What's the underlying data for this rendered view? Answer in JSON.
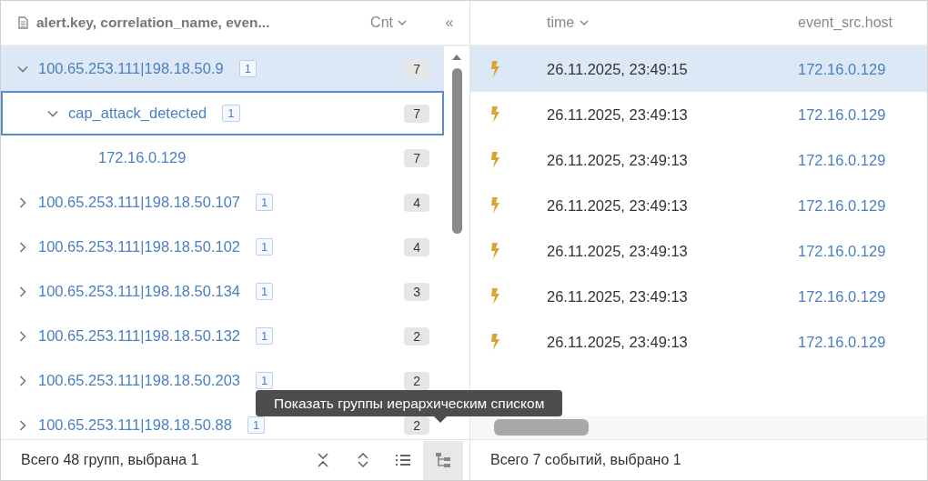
{
  "groups_panel": {
    "header": {
      "title": "alert.key, correlation_name, even...",
      "count_column": "Cnt",
      "collapse_button": "«"
    },
    "groups": [
      {
        "label": "100.65.253.111|198.18.50.9",
        "badge": "1",
        "count": "7",
        "expanded": true,
        "selected": true,
        "focused": false,
        "children": [
          {
            "label": "cap_attack_detected",
            "badge": "1",
            "count": "7",
            "expanded": true,
            "selected": false,
            "focused": true,
            "children": [
              {
                "label": "172.16.0.129",
                "count": "7",
                "selected": false,
                "focused": false
              }
            ]
          }
        ]
      },
      {
        "label": "100.65.253.111|198.18.50.107",
        "badge": "1",
        "count": "4",
        "expanded": false,
        "selected": false,
        "focused": false
      },
      {
        "label": "100.65.253.111|198.18.50.102",
        "badge": "1",
        "count": "4",
        "expanded": false,
        "selected": false,
        "focused": false
      },
      {
        "label": "100.65.253.111|198.18.50.134",
        "badge": "1",
        "count": "3",
        "expanded": false,
        "selected": false,
        "focused": false
      },
      {
        "label": "100.65.253.111|198.18.50.132",
        "badge": "1",
        "count": "2",
        "expanded": false,
        "selected": false,
        "focused": false
      },
      {
        "label": "100.65.253.111|198.18.50.203",
        "badge": "1",
        "count": "2",
        "expanded": false,
        "selected": false,
        "focused": false
      },
      {
        "label": "100.65.253.111|198.18.50.88",
        "badge": "1",
        "count": "2",
        "expanded": false,
        "selected": false,
        "focused": false
      }
    ],
    "status": "Всего 48 групп, выбрана 1",
    "view_buttons": [
      {
        "kind": "list",
        "selected": false
      },
      {
        "kind": "tree",
        "selected": true
      }
    ]
  },
  "tooltip": "Показать группы иерархическим списком",
  "events_panel": {
    "columns": [
      "time",
      "event_src.host"
    ],
    "rows": [
      {
        "time": "26.11.2025, 23:49:15",
        "host": "172.16.0.129",
        "selected": true
      },
      {
        "time": "26.11.2025, 23:49:13",
        "host": "172.16.0.129",
        "selected": false
      },
      {
        "time": "26.11.2025, 23:49:13",
        "host": "172.16.0.129",
        "selected": false
      },
      {
        "time": "26.11.2025, 23:49:13",
        "host": "172.16.0.129",
        "selected": false
      },
      {
        "time": "26.11.2025, 23:49:13",
        "host": "172.16.0.129",
        "selected": false
      },
      {
        "time": "26.11.2025, 23:49:13",
        "host": "172.16.0.129",
        "selected": false
      },
      {
        "time": "26.11.2025, 23:49:13",
        "host": "172.16.0.129",
        "selected": false
      }
    ],
    "status": "Всего 7 событий, выбрано 1"
  }
}
